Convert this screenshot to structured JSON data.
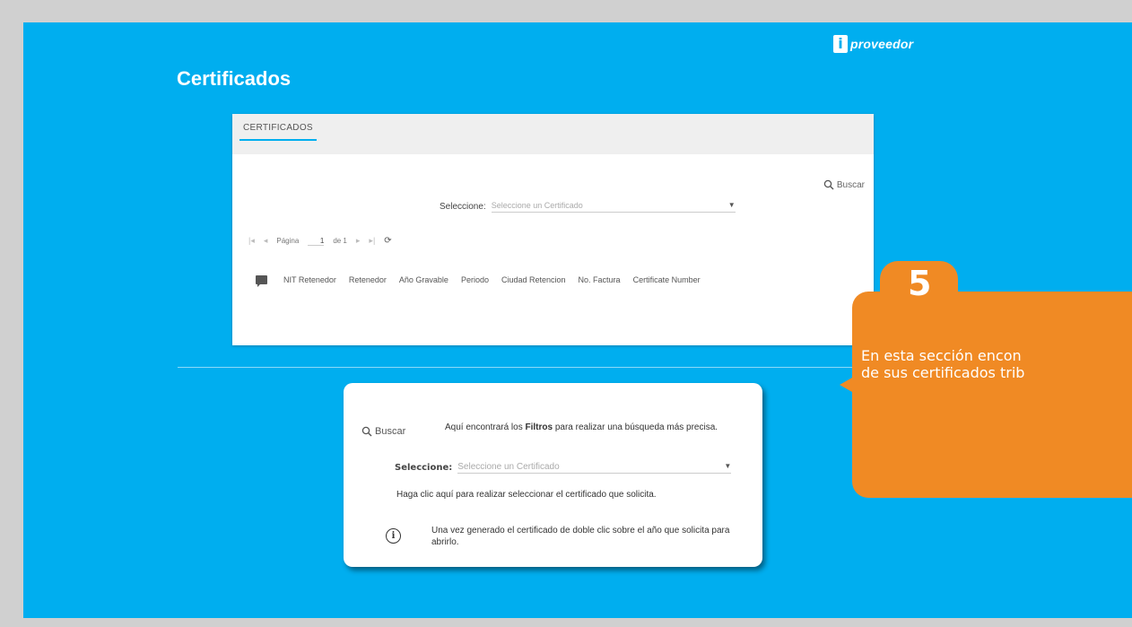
{
  "logo": {
    "mark": "i",
    "text": "proveedor"
  },
  "page_title": "Certificados",
  "panel": {
    "tab": "CERTIFICADOS",
    "search_label": "Buscar",
    "select_label": "Seleccione:",
    "select_placeholder": "Seleccione un Certificado",
    "pager": {
      "first": "|◂",
      "prev": "◂",
      "page_label": "Página",
      "page_value": "1",
      "of_label": "de 1",
      "next": "▸",
      "last": "▸|",
      "refresh": "⟳"
    },
    "columns": [
      "NIT Retenedor",
      "Retenedor",
      "Año Gravable",
      "Periodo",
      "Ciudad Retencion",
      "No. Factura",
      "Certificate Number"
    ]
  },
  "card": {
    "search_label": "Buscar",
    "filters_text_before": "Aquí encontrará los ",
    "filters_bold": "Filtros",
    "filters_text_after": " para realizar una búsqueda más precisa.",
    "select_label": "Seleccione:",
    "select_placeholder": "Seleccione un Certificado",
    "help_text": "Haga clic aquí para realizar seleccionar el certificado que solicita.",
    "info_icon": "i",
    "info_text": "Una vez generado el certificado de doble clic sobre el año que solicita para abrirlo."
  },
  "callout": {
    "number": "5",
    "line1": "En esta sección encon",
    "line2": "de sus certificados trib"
  },
  "colors": {
    "background": "#00aeef",
    "callout": "#f08a24",
    "frame": "#d0d0d0"
  }
}
